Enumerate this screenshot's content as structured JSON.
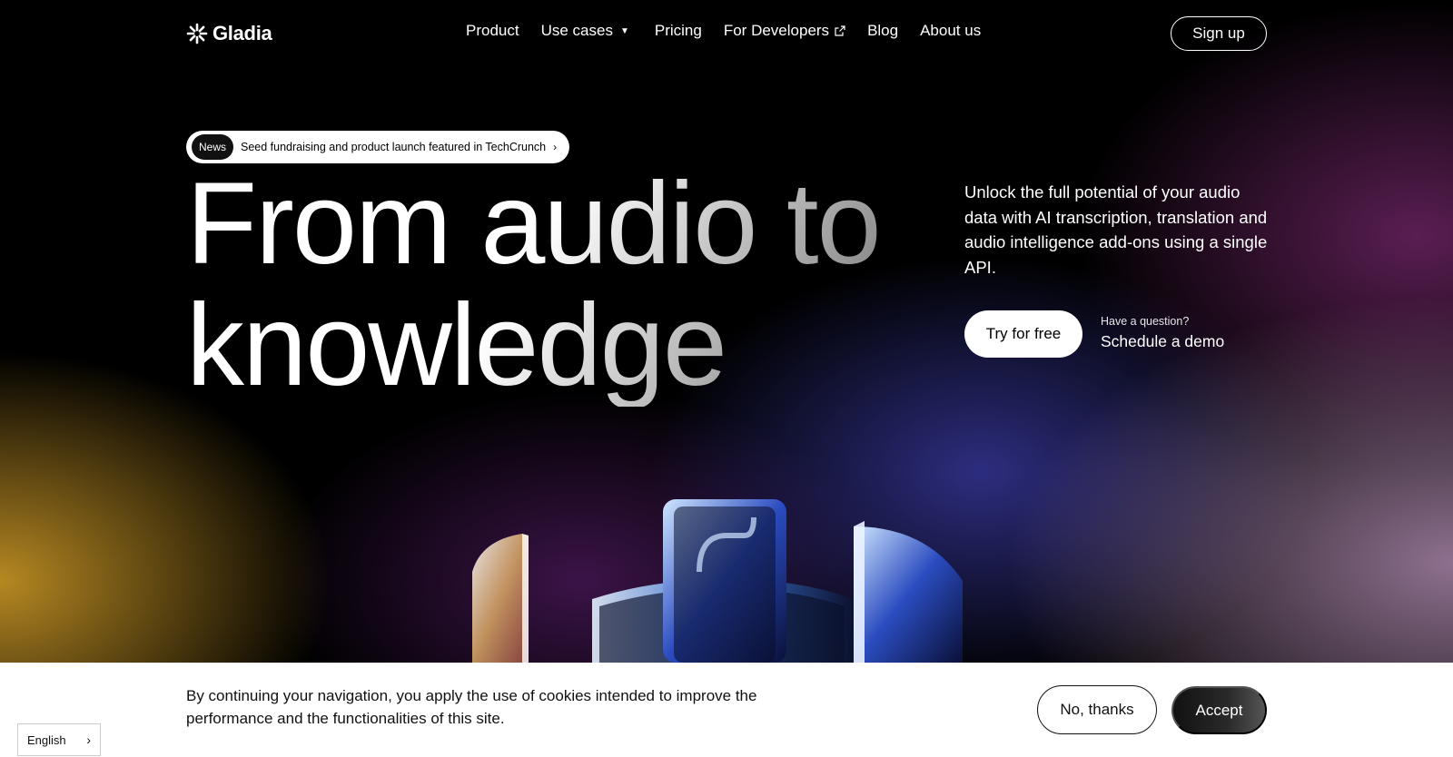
{
  "brand": {
    "name": "Gladia"
  },
  "nav": {
    "items": [
      {
        "label": "Product"
      },
      {
        "label": "Use cases",
        "has_dropdown": true
      },
      {
        "label": "Pricing"
      },
      {
        "label": "For Developers",
        "external": true
      },
      {
        "label": "Blog"
      },
      {
        "label": "About us"
      }
    ],
    "signup_label": "Sign up"
  },
  "news": {
    "tag": "News",
    "text": "Seed fundraising and product launch featured in TechCrunch"
  },
  "hero": {
    "title_line1": "From audio to",
    "title_line2": "knowledge",
    "description": "Unlock the full potential of your audio data with AI transcription, translation and audio intelligence add-ons using a single API.",
    "cta_label": "Try for free",
    "question": "Have a question?",
    "demo_label": "Schedule a demo"
  },
  "cookie": {
    "text": "By continuing your navigation, you apply the use of cookies intended to improve the performance and the functionalities of this site.",
    "decline_label": "No, thanks",
    "accept_label": "Accept",
    "language": "English"
  },
  "colors": {
    "background": "#000000",
    "text": "#ffffff",
    "cookie_bg": "#ffffff",
    "accent_gold": "#d6a028",
    "accent_purple": "#78286e",
    "accent_blue": "#3c3caa"
  }
}
